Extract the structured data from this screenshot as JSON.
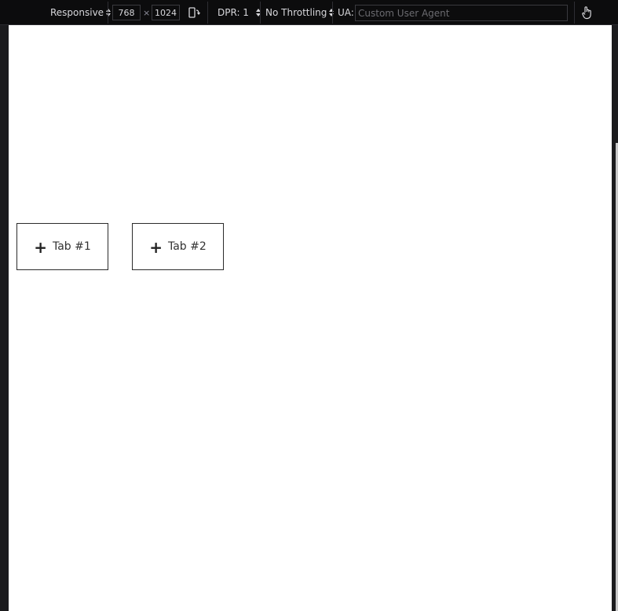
{
  "toolbar": {
    "device_select": "Responsive",
    "width_value": "768",
    "times_glyph": "×",
    "height_value": "1024",
    "dpr_label": "DPR: 1",
    "throttling_label": "No Throttling",
    "ua_label": "UA:",
    "ua_placeholder": "Custom User Agent"
  },
  "page": {
    "tabs": [
      {
        "label": "Tab #1"
      },
      {
        "label": "Tab #2"
      }
    ]
  },
  "colors": {
    "toolbar_bg": "#0c0c0d",
    "viewport_bg": "#ffffff",
    "tab_border": "#2b2b2b"
  }
}
